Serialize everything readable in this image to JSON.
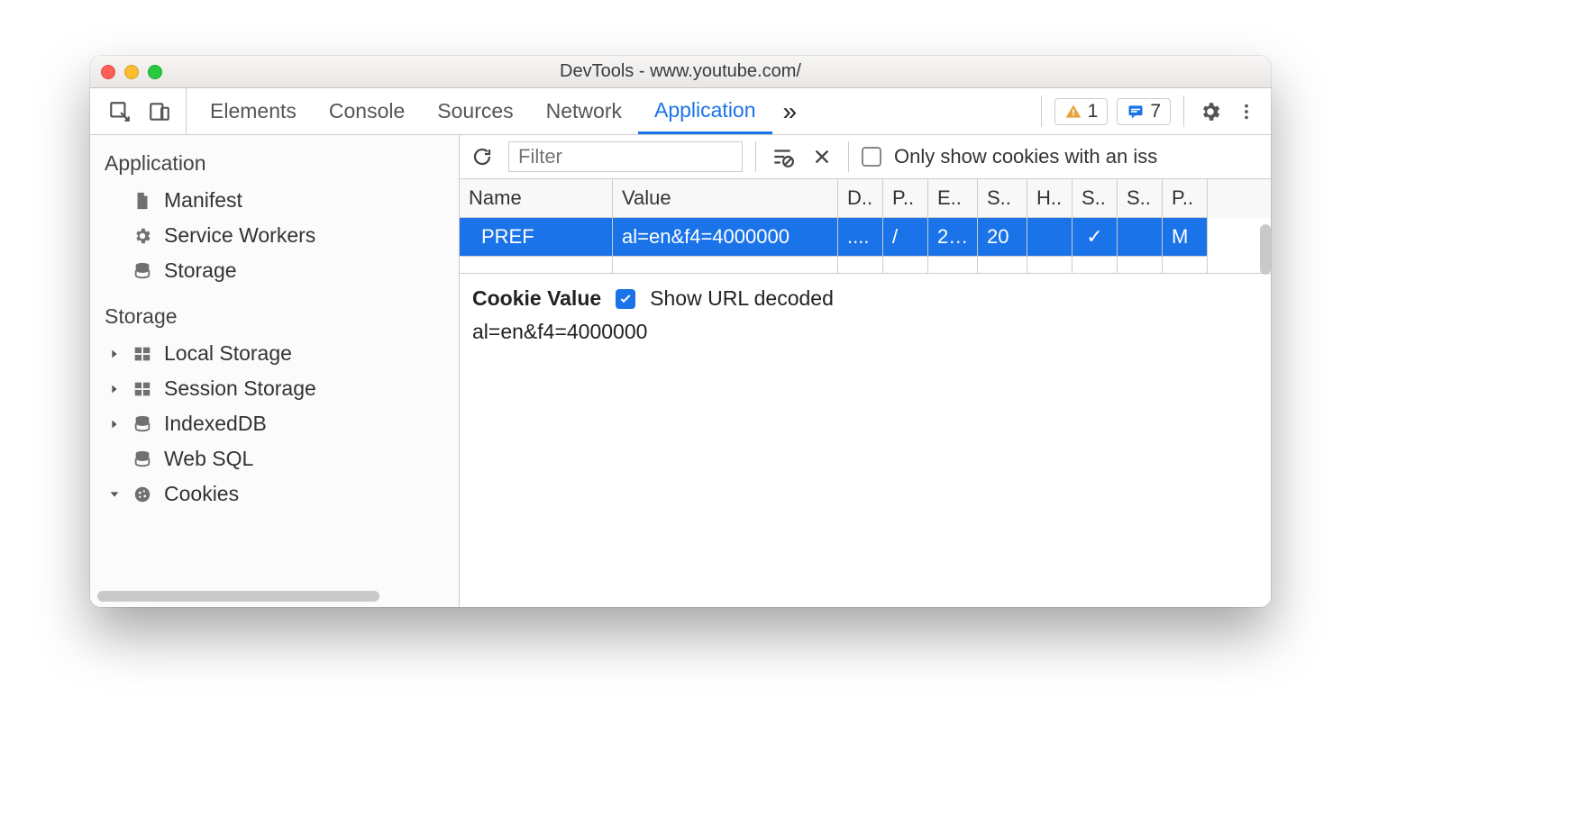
{
  "window": {
    "title": "DevTools - www.youtube.com/"
  },
  "tabs": {
    "items": [
      "Elements",
      "Console",
      "Sources",
      "Network",
      "Application"
    ],
    "active": "Application",
    "more_glyph": "»"
  },
  "badges": {
    "warnings": "1",
    "messages": "7"
  },
  "sidebar": {
    "group1_title": "Application",
    "group1_items": [
      {
        "label": "Manifest"
      },
      {
        "label": "Service Workers"
      },
      {
        "label": "Storage"
      }
    ],
    "group2_title": "Storage",
    "group2_items": [
      {
        "label": "Local Storage",
        "expandable": true,
        "expanded": false
      },
      {
        "label": "Session Storage",
        "expandable": true,
        "expanded": false
      },
      {
        "label": "IndexedDB",
        "expandable": true,
        "expanded": false
      },
      {
        "label": "Web SQL",
        "expandable": false
      },
      {
        "label": "Cookies",
        "expandable": true,
        "expanded": true
      }
    ]
  },
  "toolbar": {
    "filter_placeholder": "Filter",
    "only_issue_label": "Only show cookies with an iss"
  },
  "table": {
    "headers": [
      "Name",
      "Value",
      "D..",
      "P..",
      "E..",
      "S..",
      "H..",
      "S..",
      "S..",
      "P.."
    ],
    "rows": [
      {
        "selected": true,
        "cells": [
          "PREF",
          "al=en&f4=4000000",
          "....",
          "/",
          "2…",
          "20",
          "",
          "✓",
          "",
          "M"
        ]
      }
    ]
  },
  "details": {
    "cookie_value_label": "Cookie Value",
    "show_decoded_label": "Show URL decoded",
    "show_decoded_checked": true,
    "decoded_value": "al=en&f4=4000000"
  }
}
